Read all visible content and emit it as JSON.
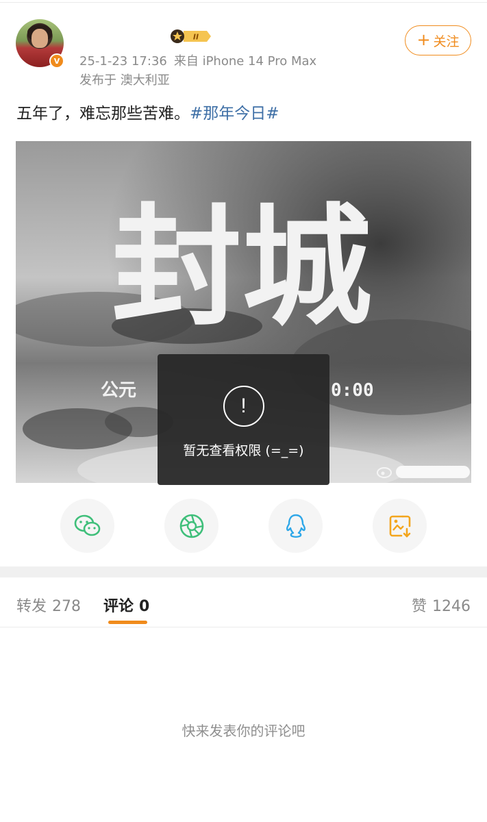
{
  "post": {
    "username": "",
    "timestamp": "25-1-23 17:36",
    "source": "来自 iPhone 14 Pro Max",
    "location": "发布于 澳大利亚",
    "text": "五年了，难忘那些苦难。",
    "hashtag": "#那年今日#",
    "level_badge": "II",
    "verified_badge": "V"
  },
  "follow_button": {
    "plus": "+",
    "label": "关注"
  },
  "image": {
    "big_text": "封城",
    "subtitle_left": "公元",
    "subtitle_right": "0:00"
  },
  "toast": {
    "icon": "!",
    "message": "暂无查看权限 (=_=)"
  },
  "share": {
    "items": [
      {
        "icon": "wechat-icon",
        "color": "#3fbf7a"
      },
      {
        "icon": "moments-icon",
        "color": "#3fbf7a"
      },
      {
        "icon": "qq-icon",
        "color": "#2ea7e8"
      },
      {
        "icon": "save-image-icon",
        "color": "#f3a51d"
      }
    ]
  },
  "tabs": {
    "repost_label": "转发",
    "repost_count": "278",
    "comment_label": "评论",
    "comment_count": "0",
    "like_label": "赞",
    "like_count": "1246"
  },
  "comments": {
    "empty_text": "快来发表你的评论吧"
  },
  "colors": {
    "accent": "#f08b1c",
    "hashtag": "#3e6fa6",
    "muted": "#8a8a8a"
  }
}
